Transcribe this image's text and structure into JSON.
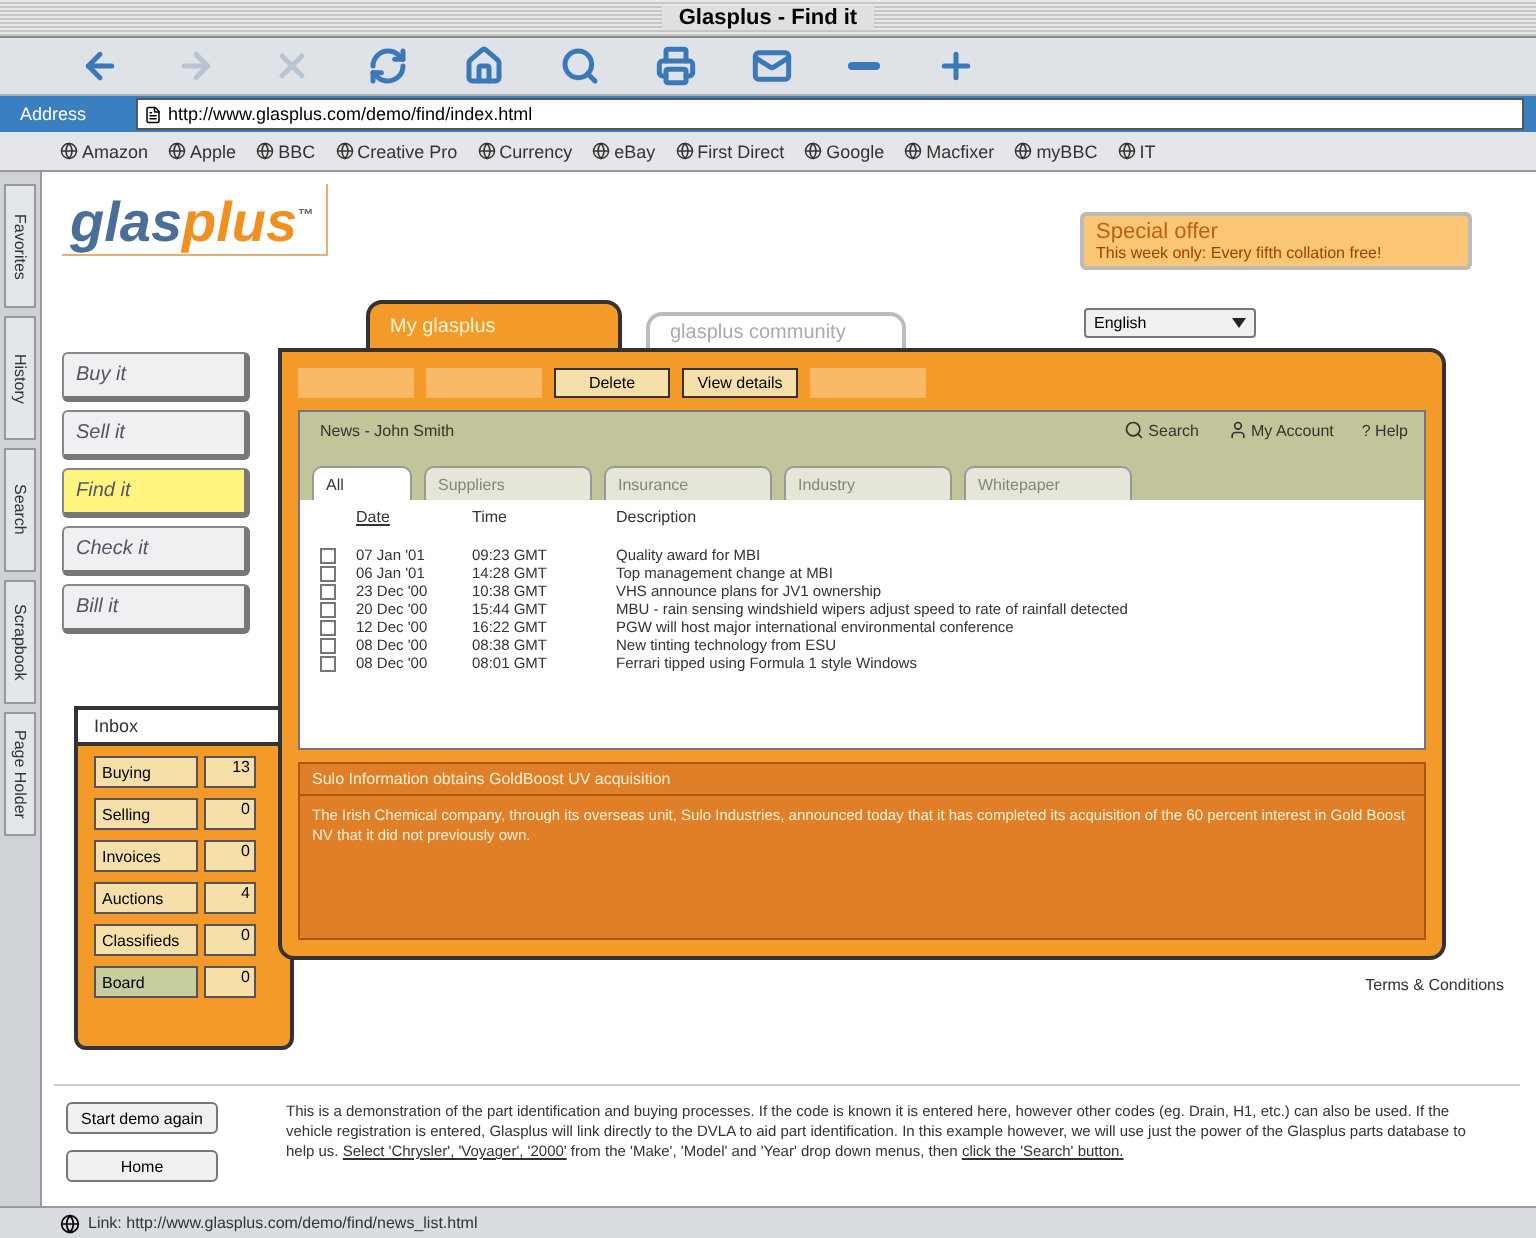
{
  "window": {
    "title": "Glasplus - Find it"
  },
  "toolbar": [
    {
      "kind": "back",
      "disabled": false
    },
    {
      "kind": "forward",
      "disabled": true
    },
    {
      "kind": "stop",
      "disabled": true
    },
    {
      "kind": "refresh",
      "disabled": false
    },
    {
      "kind": "home",
      "disabled": false
    },
    {
      "kind": "search",
      "disabled": false
    },
    {
      "kind": "print",
      "disabled": false
    },
    {
      "kind": "mail",
      "disabled": false
    },
    {
      "kind": "smaller",
      "disabled": false
    },
    {
      "kind": "larger",
      "disabled": false
    }
  ],
  "address_bar": {
    "label": "Address",
    "value": "http://www.glasplus.com/demo/find/index.html"
  },
  "favorites_bar": [
    "Amazon",
    "Apple",
    "BBC",
    "Creative Pro",
    "Currency",
    "eBay",
    "First Direct",
    "Google",
    "Macfixer",
    "myBBC",
    "IT"
  ],
  "side_tabs": [
    "Favorites",
    "History",
    "Search",
    "Scrapbook",
    "Page Holder"
  ],
  "logo": {
    "text": "glas",
    "accent": "plus",
    "mark": "™"
  },
  "special_offer": {
    "title": "Special offer",
    "text": "This week only: Every fifth collation free!"
  },
  "language": {
    "value": "English"
  },
  "nav": [
    {
      "label": "Buy it",
      "selected": false
    },
    {
      "label": "Sell it",
      "selected": false
    },
    {
      "label": "Find it",
      "selected": true
    },
    {
      "label": "Check it",
      "selected": false
    },
    {
      "label": "Bill it",
      "selected": false
    }
  ],
  "main_tabs": [
    {
      "label": "My glasplus",
      "selected": true
    },
    {
      "label": "glasplus community",
      "selected": false
    }
  ],
  "actions": [
    {
      "kind": "blank"
    },
    {
      "kind": "blank"
    },
    {
      "kind": "button",
      "label": "Delete"
    },
    {
      "kind": "button",
      "label": "View details"
    },
    {
      "kind": "blank"
    }
  ],
  "news": {
    "title": "News - John Smith",
    "links": [
      {
        "kind": "search",
        "label": "Search"
      },
      {
        "kind": "account",
        "label": "My Account"
      },
      {
        "kind": "help",
        "label": "? Help"
      }
    ],
    "tabs": [
      {
        "label": "All",
        "selected": true,
        "disabled": false
      },
      {
        "label": "Suppliers",
        "selected": false,
        "disabled": true
      },
      {
        "label": "Insurance",
        "selected": false,
        "disabled": true
      },
      {
        "label": "Industry",
        "selected": false,
        "disabled": true
      },
      {
        "label": "Whitepaper",
        "selected": false,
        "disabled": true
      }
    ],
    "columns": [
      "Date",
      "Time",
      "Description"
    ],
    "rows": [
      {
        "date": "07 Jan '01",
        "time": "09:23 GMT",
        "description": "Quality award for MBI",
        "checked": false
      },
      {
        "date": "06 Jan '01",
        "time": "14:28 GMT",
        "description": "Top management change at MBI",
        "checked": false
      },
      {
        "date": "23 Dec '00",
        "time": "10:38 GMT",
        "description": "VHS announce plans for JV1 ownership",
        "checked": false
      },
      {
        "date": "20 Dec '00",
        "time": "15:44 GMT",
        "description": "MBU - rain sensing windshield wipers adjust speed to rate of rainfall detected",
        "checked": false
      },
      {
        "date": "12 Dec '00",
        "time": "16:22 GMT",
        "description": "PGW will host major international environmental conference",
        "checked": false
      },
      {
        "date": "08 Dec '00",
        "time": "08:38 GMT",
        "description": "New tinting technology from ESU",
        "checked": false
      },
      {
        "date": "08 Dec '00",
        "time": "08:01 GMT",
        "description": "Ferrari tipped using Formula 1 style Windows",
        "checked": false
      }
    ]
  },
  "article": {
    "title": "Sulo Information obtains GoldBoost UV acquisition",
    "body": "The Irish Chemical company, through its overseas unit, Sulo Industries, announced today that it has completed its acquisition of the 60 percent interest in Gold Boost NV that it did not previously own."
  },
  "mailbox": {
    "title": "Inbox",
    "items": [
      {
        "label": "Buying",
        "count": "13",
        "kind": "folder"
      },
      {
        "label": "Selling",
        "count": "0",
        "kind": "folder"
      },
      {
        "label": "Invoices",
        "count": "0",
        "kind": "folder"
      },
      {
        "label": "Auctions",
        "count": "4",
        "kind": "folder"
      },
      {
        "label": "Classifieds",
        "count": "0",
        "kind": "folder"
      },
      {
        "label": "Board",
        "count": "0",
        "kind": "board"
      }
    ]
  },
  "terms_link": "Terms & Conditions",
  "footer": {
    "buttons": [
      "Start demo again",
      "Home"
    ],
    "text": "This is a demonstration of the part identification and buying processes. If the code is known it is entered here, however other codes (eg. Drain, H1, etc.) can also be used. If the vehicle registration is entered, Glasplus will link directly to the DVLA to aid part identification. In this example however, we will use just the power of the Glasplus parts database to help us. ",
    "link1": "Select 'Chrysler', 'Voyager', '2000'",
    "middle": " from the 'Make', 'Model' and 'Year' drop down menus, then ",
    "link2": "click the 'Search' button."
  },
  "status_bar": {
    "text": "Link: http://www.glasplus.com/demo/find/news_list.html"
  }
}
